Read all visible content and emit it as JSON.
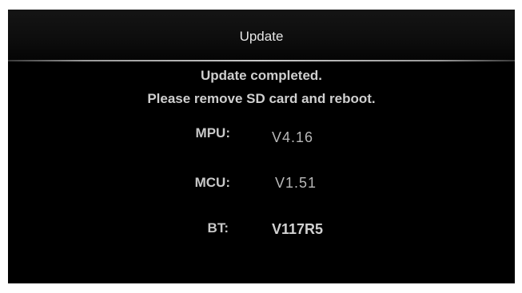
{
  "header": {
    "title": "Update"
  },
  "message": {
    "line1": "Update completed.",
    "line2": "Please remove SD card and reboot."
  },
  "versions": [
    {
      "label": "MPU:",
      "value": "V4.16"
    },
    {
      "label": "MCU:",
      "value": "V1.51"
    },
    {
      "label": "BT:",
      "value": "V117R5"
    }
  ]
}
